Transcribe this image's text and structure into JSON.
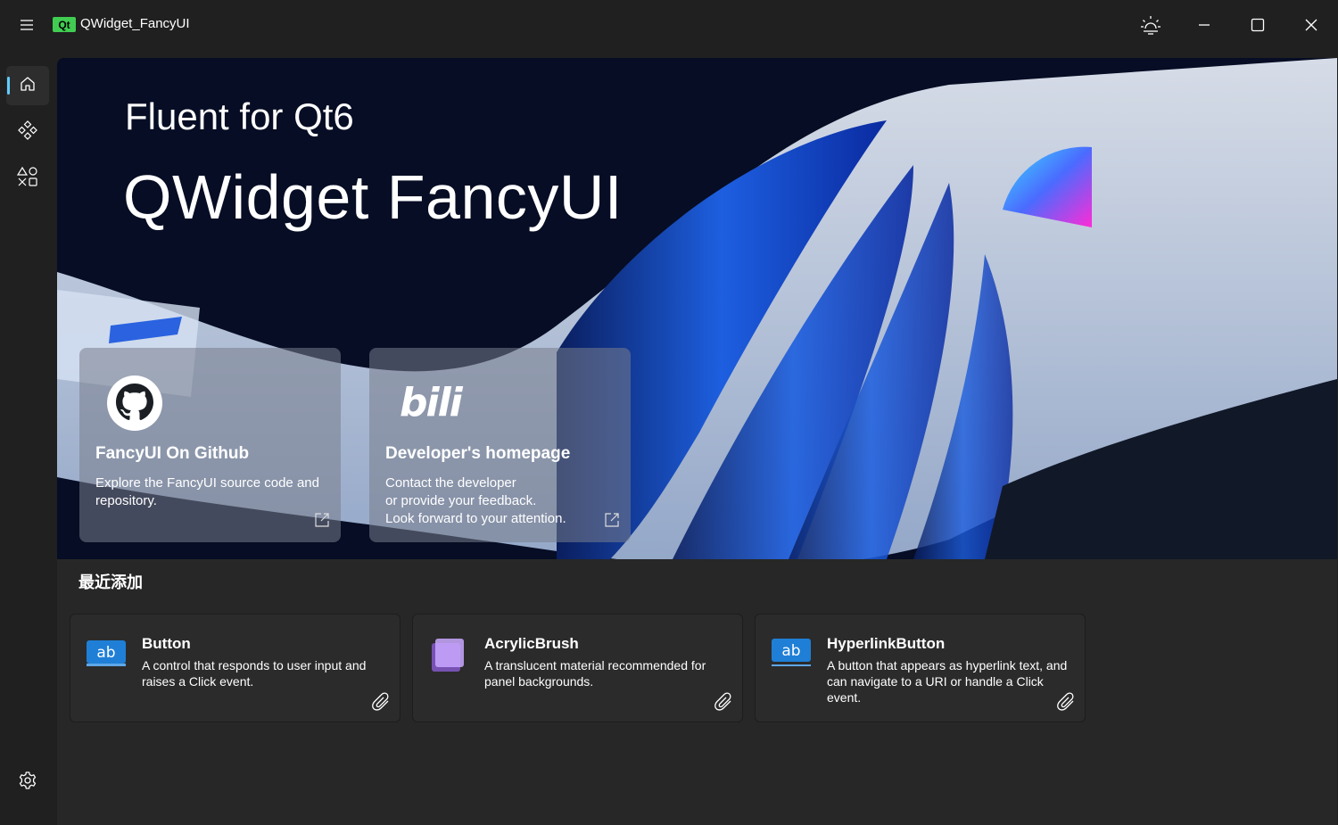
{
  "titlebar": {
    "qt_badge": "Qt",
    "title": "QWidget_FancyUI"
  },
  "hero": {
    "subtitle": "Fluent for Qt6",
    "title": "QWidget FancyUI"
  },
  "link_cards": [
    {
      "icon": "github-icon",
      "title": "FancyUI On Github",
      "description": "Explore the FancyUI source code and repository."
    },
    {
      "icon": "bilibili-icon",
      "logo_text": "bili",
      "title": "Developer's homepage",
      "description": "Contact the developer\nor provide your feedback.\nLook forward to your attention."
    }
  ],
  "recent": {
    "section_title": "最近添加",
    "cards": [
      {
        "icon_label": "ab",
        "title": "Button",
        "description": "A control that responds to user input and raises a Click event."
      },
      {
        "icon_label": "",
        "title": "AcrylicBrush",
        "description": "A translucent material recommended for panel backgrounds."
      },
      {
        "icon_label": "ab",
        "title": "HyperlinkButton",
        "description": "A button that appears as hyperlink text, and can navigate to a URI or handle a Click event."
      }
    ]
  },
  "colors": {
    "accent": "#60cdff",
    "qt_green": "#41cd52",
    "window_bg": "#202020",
    "content_bg": "#272727",
    "card_bg": "#2b2b2b"
  }
}
